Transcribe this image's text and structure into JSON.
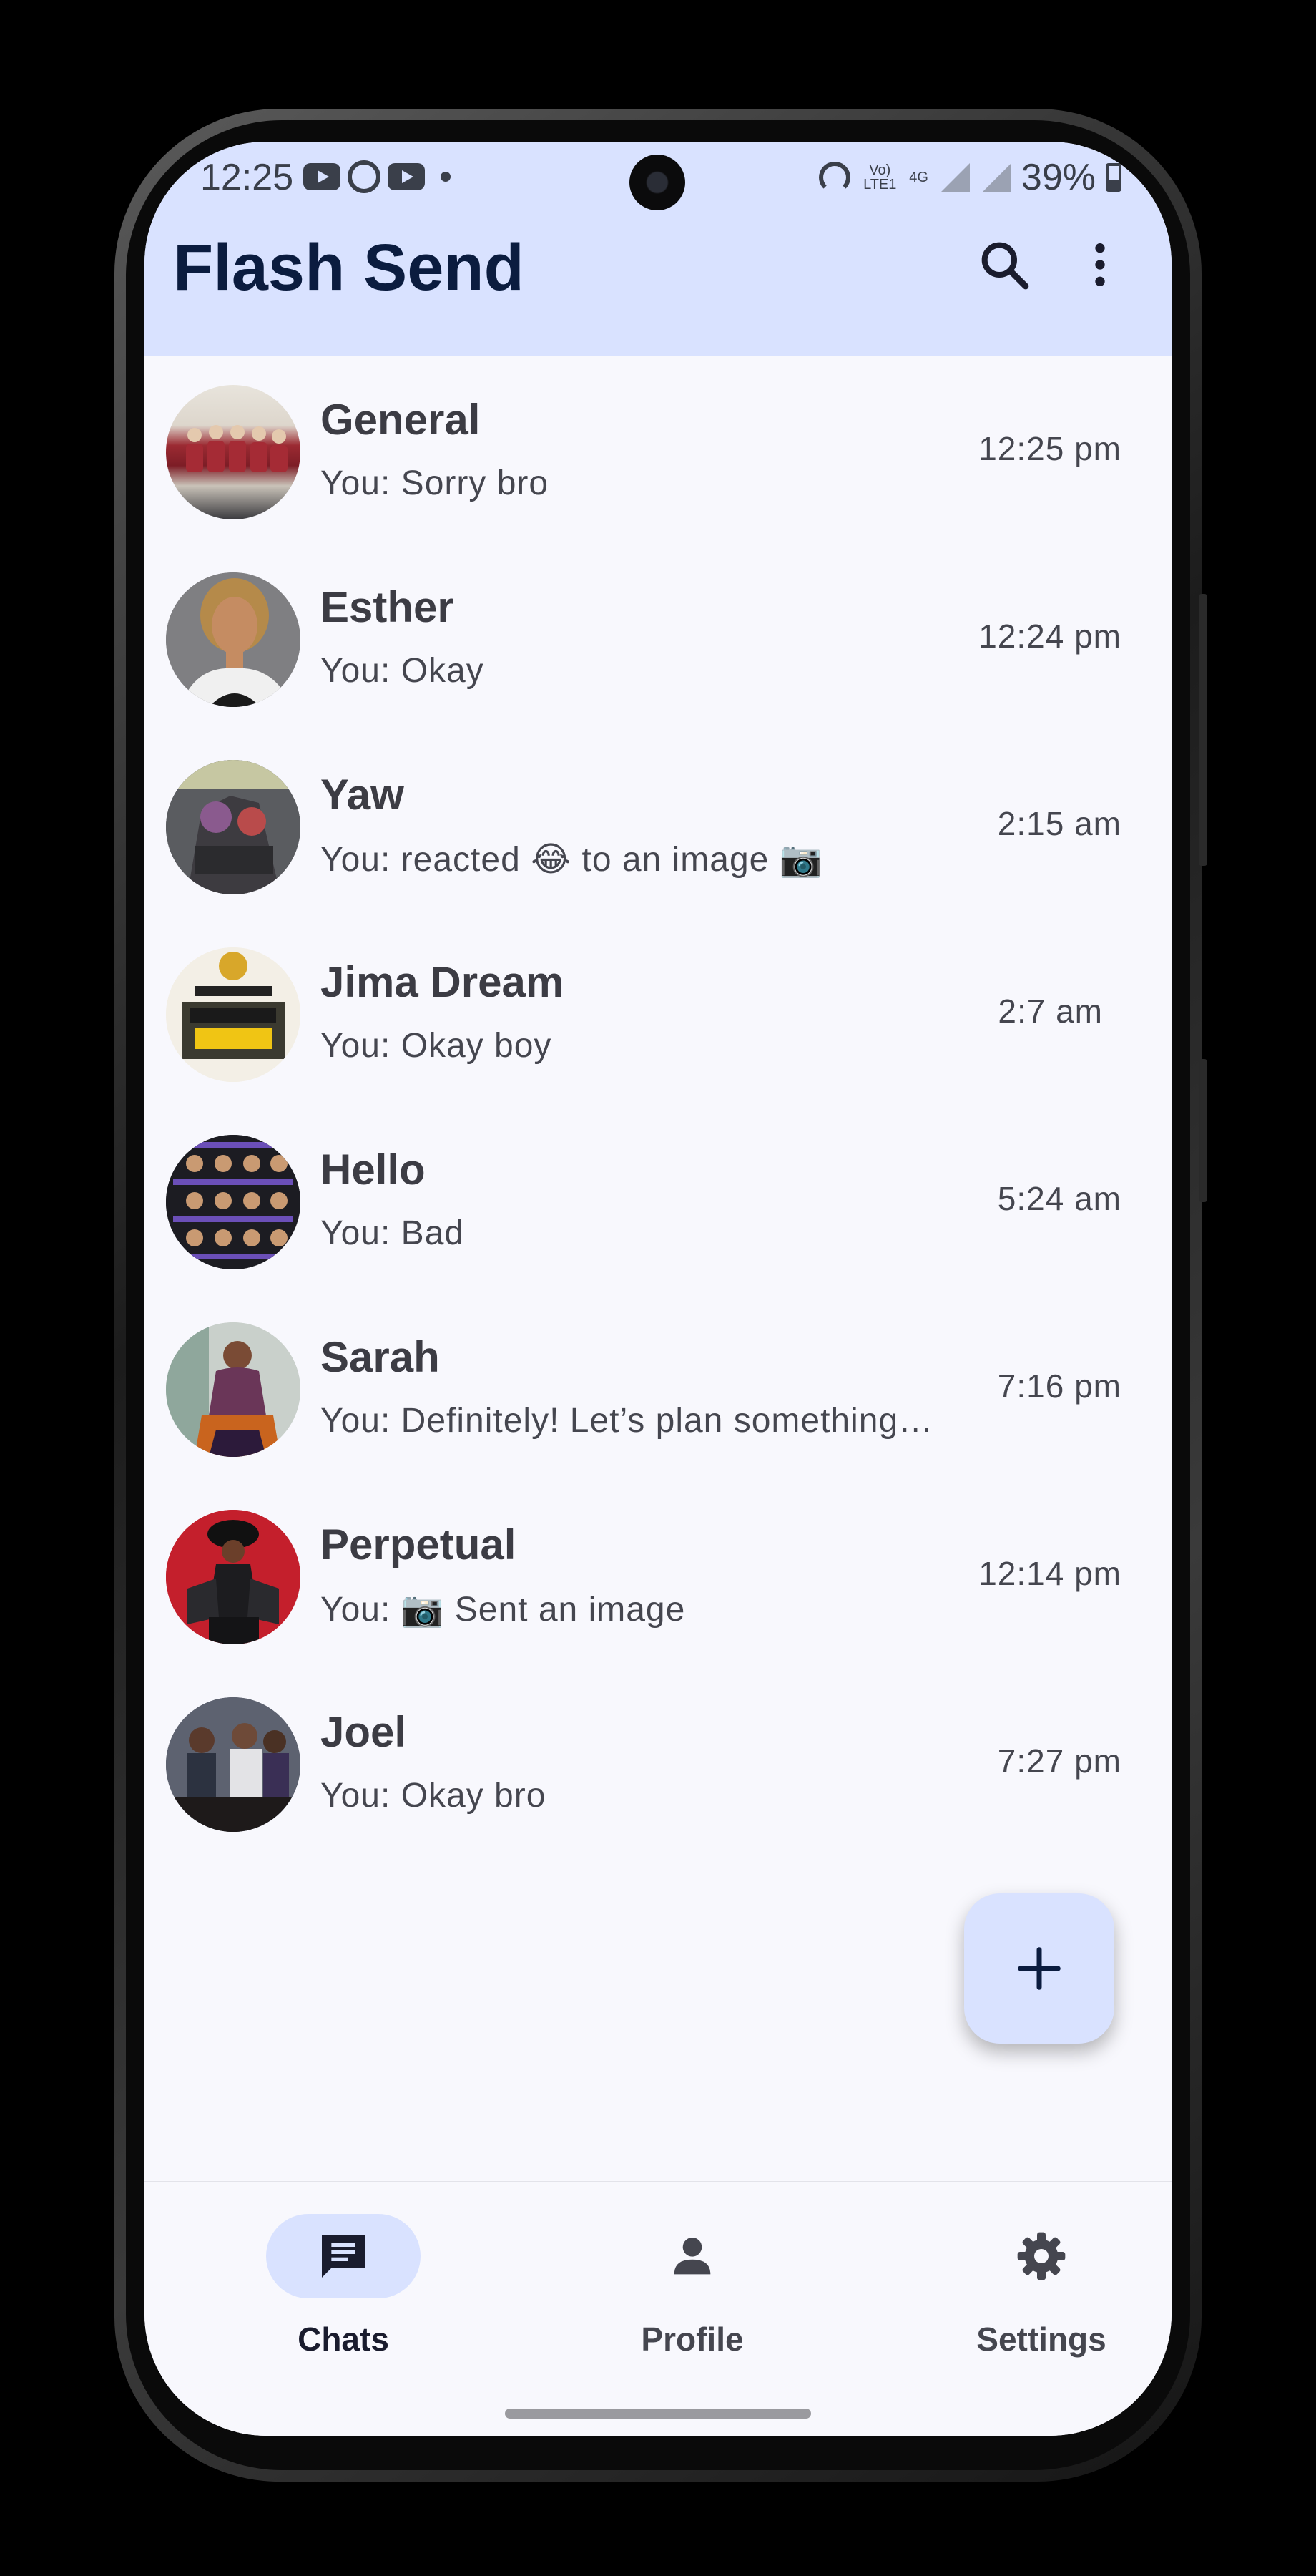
{
  "status_bar": {
    "time": "12:25",
    "network": "Vo) LTE1",
    "network_4g": "4G",
    "battery": "39%"
  },
  "app_bar": {
    "title": "Flash Send"
  },
  "chats": [
    {
      "name": "General",
      "preview": "You: Sorry bro",
      "time": "12:25 pm"
    },
    {
      "name": "Esther",
      "preview": "You: Okay",
      "time": "12:24 pm"
    },
    {
      "name": "Yaw",
      "preview": "You: reacted 😂 to an image 📷",
      "time": "2:15 am"
    },
    {
      "name": "Jima Dream",
      "preview": "You: Okay boy",
      "time": "2:7 am"
    },
    {
      "name": "Hello",
      "preview": "You: Bad",
      "time": "5:24 am"
    },
    {
      "name": "Sarah",
      "preview": "You: Definitely! Let’s plan something…",
      "time": "7:16 pm"
    },
    {
      "name": "Perpetual",
      "preview": "You: 📷 Sent an image",
      "time": "12:14 pm"
    },
    {
      "name": "Joel",
      "preview": "You: Okay bro",
      "time": "7:27 pm"
    }
  ],
  "nav": {
    "chats": "Chats",
    "profile": "Profile",
    "settings": "Settings"
  },
  "colors": {
    "app_bar_bg": "#d9e2ff",
    "title": "#0b1c3f",
    "screen_bg": "#f8f8fd",
    "active_pill": "#d9e2ff"
  },
  "icons": [
    "search-icon",
    "more-vert-icon",
    "add-icon",
    "chat-icon",
    "person-icon",
    "gear-icon"
  ]
}
